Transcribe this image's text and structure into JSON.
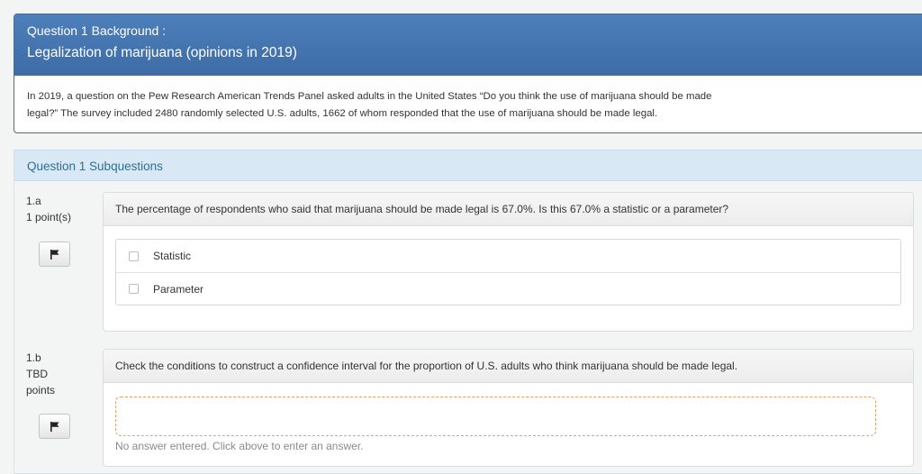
{
  "background": {
    "label": "Question 1 Background :",
    "title": "Legalization of marijuana (opinions in 2019)",
    "text_line1": "In 2019, a question on the Pew Research American Trends Panel asked adults in the United States “Do you think the use of marijuana should be made",
    "text_line2": "legal?” The survey included 2480 randomly selected U.S. adults, 1662 of whom responded that the use of marijuana should be made legal."
  },
  "subquestions": {
    "header": "Question 1 Subquestions",
    "items": [
      {
        "number": "1.a",
        "points_line1": "1 point(s)",
        "points_line2": "",
        "question": "The percentage of respondents who said that marijuana should be made legal is 67.0%. Is this 67.0% a statistic or a parameter?",
        "choices": [
          "Statistic",
          "Parameter"
        ]
      },
      {
        "number": "1.b",
        "points_line1": "TBD",
        "points_line2": "points",
        "question": "Check the conditions to construct a confidence interval for the proportion of U.S. adults who think marijuana should be made legal.",
        "answer_hint": "No answer entered. Click above to enter an answer."
      }
    ]
  },
  "icons": {
    "flag": "flag-icon",
    "checkbox": "checkbox-icon"
  }
}
